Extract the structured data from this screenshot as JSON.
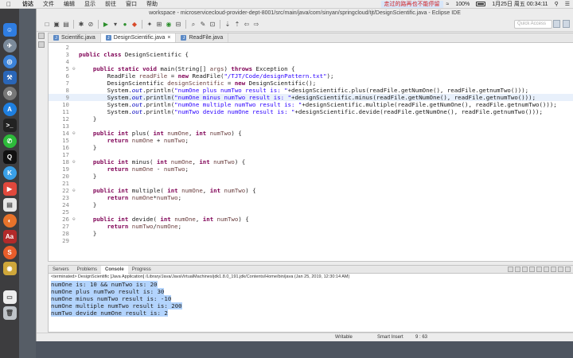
{
  "menubar": {
    "items": [
      "访达",
      "文件",
      "编辑",
      "显示",
      "前往",
      "窗口",
      "帮助"
    ],
    "notification": "走过的路再也不能停留",
    "battery": "100%",
    "datetime": "1月25日 周五   00:34:11"
  },
  "window": {
    "title": "workspace - microservicecloud-provider-dept-8001/src/main/java/com/sinyan/springcloud/tjt/DesignScientific.java - Eclipse IDE",
    "quick_access_placeholder": "Quick Access"
  },
  "editor": {
    "tabs": [
      {
        "label": "Scientific.java",
        "active": false
      },
      {
        "label": "DesignScientific.java",
        "active": true
      },
      {
        "label": "ReadFile.java",
        "active": false
      }
    ]
  },
  "code": {
    "line_numbers": [
      "2",
      "3",
      "4",
      "5",
      "6",
      "7",
      "8",
      "9",
      "10",
      "11",
      "12",
      "13",
      "14",
      "15",
      "16",
      "17",
      "18",
      "19",
      "20",
      "21",
      "22",
      "23",
      "24",
      "25",
      "26",
      "27",
      "28",
      "29"
    ],
    "l3_kw": "public class ",
    "l3_rest": "DesignScientific {",
    "l5_kw1": "public static void ",
    "l5_mid": "main(String[] ",
    "l5_var": "args",
    "l5_rp": ") ",
    "l5_kw2": "throws ",
    "l5_rest": "Exception {",
    "l6_a": "ReadFile ",
    "l6_var": "readFile",
    "l6_b": " = ",
    "l6_kw": "new ",
    "l6_c": "ReadFile(",
    "l6_str": "\"/TJT/Code/designPattern.txt\"",
    "l6_d": ");",
    "l7_a": "DesignScientific ",
    "l7_var": "designScientific",
    "l7_b": " = ",
    "l7_kw": "new ",
    "l7_c": "DesignScientific();",
    "println_prefix": "System.",
    "println_field": "out",
    "println_mid": ".println(",
    "l8_str": "\"numOne plus numTwo result is: \"",
    "l8_rest": "+designScientific.plus(readFile.getNumOne(), readFile.getnumTwo()));",
    "l9_str": "\"numOne minus numTwo result is: \"",
    "l9_rest": "+designScientific.minus(readFile.getNumOne(), readFile.getnumTwo()));",
    "l10_str": "\"numOne multiple numTwo result is: \"",
    "l10_rest": "+designScientific.multiple(readFile.getNumOne(), readFile.getnumTwo()));",
    "l11_str": "\"numTwo devide numOne result is: \"",
    "l11_rest": "+designScientific.devide(readFile.getNumOne(), readFile.getnumTwo()));",
    "close": "}",
    "kw_public_int": "public int ",
    "kw_int": "int ",
    "kw_return": "return ",
    "l14_name": "plus( ",
    "l18_name": "minus( ",
    "l22_name": "multiple( ",
    "l26_name": "devide( ",
    "p_numOne": "numOne",
    "p_numTwo": "numTwo",
    "comma": ", ",
    "sig_end": ") {",
    "ret_plus_op": " + ",
    "ret_minus_op": " - ",
    "ret_mul_op": "*",
    "ret_div_op": "/",
    "semi": ";"
  },
  "console": {
    "tabs": [
      "Servers",
      "Problems",
      "Console",
      "Progress"
    ],
    "terminated": "<terminated> DesignScientific [Java Application] /Library/Java/JavaVirtualMachines/jdk1.8.0_191.jdk/Contents/Home/bin/java (Jan 25, 2019, 12:30:14 AM)",
    "output": [
      "numOne is: 10 && numTwo is: 20",
      "numOne plus numTwo result is: 30",
      "numOne minus numTwo result is: -10",
      "numOne multiple numTwo result is: 200",
      "numTwo devide numOne result is: 2"
    ]
  },
  "status": {
    "writable": "Writable",
    "insert_mode": "Smart Insert",
    "position": "9 : 63"
  }
}
